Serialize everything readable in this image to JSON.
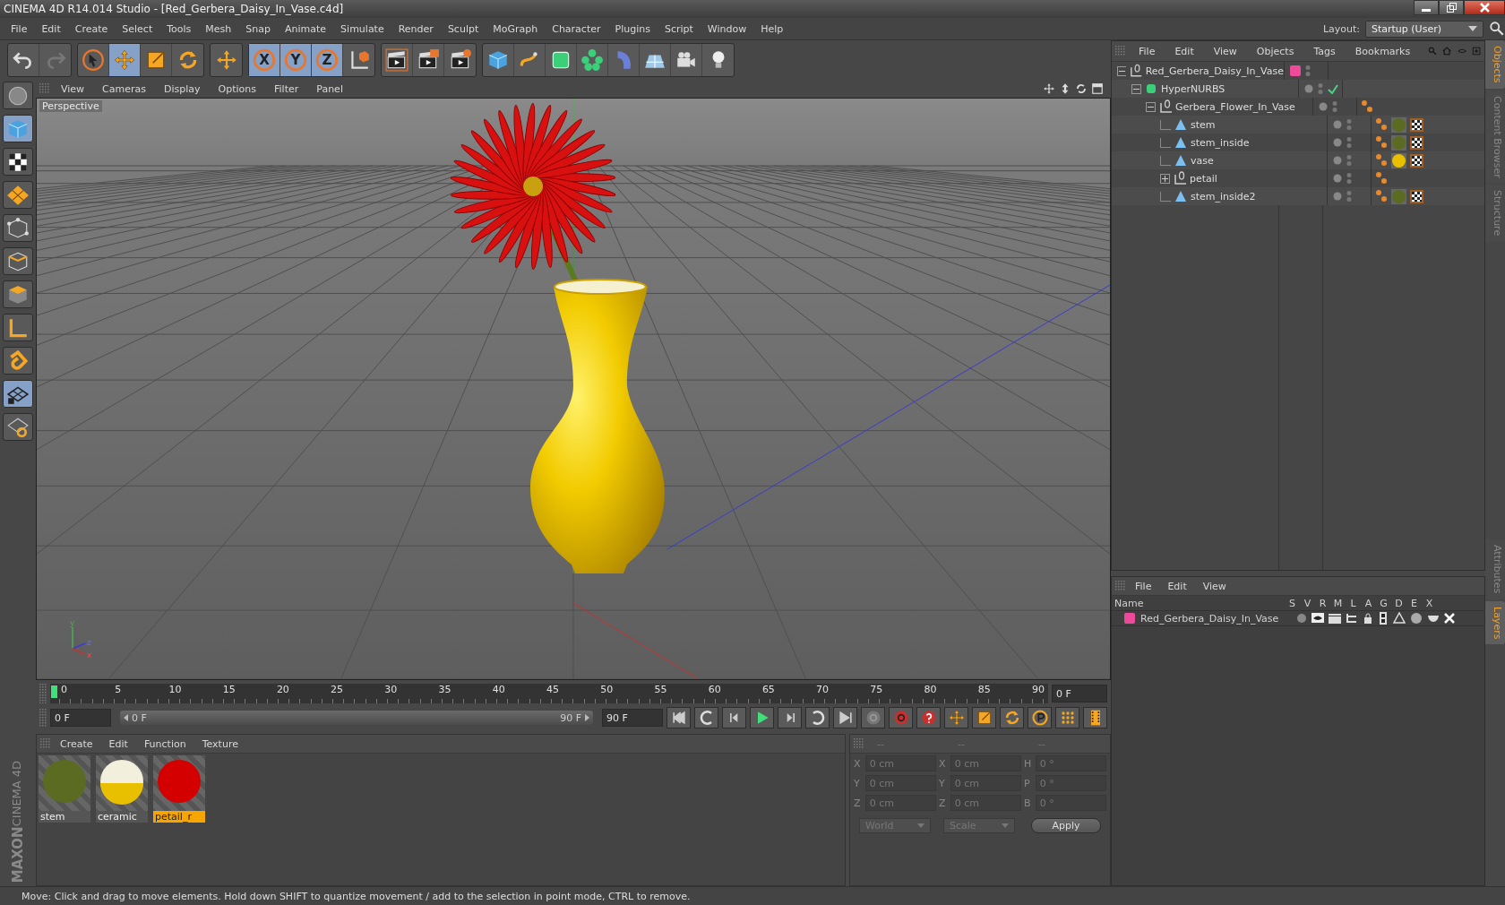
{
  "window": {
    "title": "CINEMA 4D R14.014 Studio - [Red_Gerbera_Daisy_In_Vase.c4d]"
  },
  "menu": [
    "File",
    "Edit",
    "Create",
    "Select",
    "Tools",
    "Mesh",
    "Snap",
    "Animate",
    "Simulate",
    "Render",
    "Sculpt",
    "MoGraph",
    "Character",
    "Plugins",
    "Script",
    "Window",
    "Help"
  ],
  "layout": {
    "label": "Layout:",
    "value": "Startup (User)"
  },
  "toolbar": [
    {
      "items": [
        {
          "kind": "undo",
          "selected": false
        },
        {
          "kind": "redo",
          "selected": false
        }
      ]
    },
    {
      "items": [
        {
          "kind": "select",
          "selected": false
        },
        {
          "kind": "move",
          "selected": true
        },
        {
          "kind": "scale",
          "selected": false
        },
        {
          "kind": "rotate",
          "selected": false
        }
      ]
    },
    {
      "items": [
        {
          "kind": "cross",
          "selected": false
        }
      ]
    },
    {
      "items": [
        {
          "kind": "axis",
          "label": "X",
          "selected": true
        },
        {
          "kind": "axis",
          "label": "Y",
          "selected": true
        },
        {
          "kind": "axis",
          "label": "Z",
          "selected": true
        },
        {
          "kind": "coord",
          "selected": false
        }
      ]
    },
    {
      "items": [
        {
          "kind": "render",
          "selected": false
        },
        {
          "kind": "render2",
          "selected": false
        },
        {
          "kind": "render3",
          "selected": false
        }
      ]
    },
    {
      "items": [
        {
          "kind": "cube",
          "selected": false
        },
        {
          "kind": "spline",
          "selected": false
        },
        {
          "kind": "nurbs",
          "selected": false
        },
        {
          "kind": "cloner",
          "selected": false
        },
        {
          "kind": "bend",
          "selected": false
        },
        {
          "kind": "floor",
          "selected": false
        },
        {
          "kind": "camera",
          "selected": false
        },
        {
          "kind": "light",
          "selected": false
        }
      ]
    }
  ],
  "left_tools": [
    {
      "kind": "ball",
      "selected": false
    },
    {
      "kind": "cube",
      "selected": true
    },
    {
      "kind": "checker",
      "selected": false
    },
    {
      "kind": "plane",
      "selected": false
    },
    {
      "kind": "points",
      "selected": false
    },
    {
      "kind": "edges",
      "selected": false
    },
    {
      "kind": "faces",
      "selected": false
    },
    {
      "kind": "corner",
      "selected": false
    },
    {
      "kind": "magnet",
      "selected": false
    },
    {
      "kind": "lockgrid",
      "selected": true
    },
    {
      "kind": "rotgrid",
      "selected": false
    }
  ],
  "logo": {
    "brand": "MAXON",
    "product": "CINEMA 4D"
  },
  "viewport": {
    "menu": [
      "View",
      "Cameras",
      "Display",
      "Options",
      "Filter",
      "Panel"
    ],
    "camera": "Perspective",
    "axes": [
      "y",
      "z",
      "x"
    ]
  },
  "timeline": {
    "ticks": [
      "0",
      "5",
      "10",
      "15",
      "20",
      "25",
      "30",
      "35",
      "40",
      "45",
      "50",
      "55",
      "60",
      "65",
      "70",
      "75",
      "80",
      "85",
      "90"
    ],
    "current": "0 F",
    "start": "0 F",
    "range": {
      "start": "0 F",
      "end": "90 F",
      "level": 1
    },
    "end": "90 F"
  },
  "transport": [
    {
      "kind": "first"
    },
    {
      "kind": "loopback"
    },
    {
      "kind": "stepback"
    },
    {
      "kind": "play"
    },
    {
      "kind": "stepfwd"
    },
    {
      "kind": "loopfwd"
    },
    {
      "kind": "last"
    },
    {
      "kind": "recoff"
    },
    {
      "kind": "recauto"
    },
    {
      "kind": "help"
    },
    {
      "kind": "move"
    },
    {
      "kind": "scale"
    },
    {
      "kind": "rotate"
    },
    {
      "kind": "param"
    },
    {
      "kind": "dots"
    },
    {
      "kind": "film"
    }
  ],
  "materials": {
    "menu": [
      "Create",
      "Edit",
      "Function",
      "Texture"
    ],
    "items": [
      {
        "name": "stem",
        "kind": "solid",
        "color": "#5b6b22",
        "selected": false
      },
      {
        "name": "ceramic",
        "kind": "twotone",
        "color": "#e8c000",
        "selected": false
      },
      {
        "name": "petail_r",
        "kind": "solid",
        "color": "#d40000",
        "selected": true
      }
    ]
  },
  "coordinates": {
    "headers": [
      "--",
      "--",
      "--"
    ],
    "rows": [
      {
        "labels": [
          "X",
          "X",
          "H"
        ],
        "values": [
          "0 cm",
          "0 cm",
          "0 °"
        ]
      },
      {
        "labels": [
          "Y",
          "Y",
          "P"
        ],
        "values": [
          "0 cm",
          "0 cm",
          "0 °"
        ]
      },
      {
        "labels": [
          "Z",
          "Z",
          "B"
        ],
        "values": [
          "0 cm",
          "0 cm",
          "0 °"
        ]
      }
    ],
    "dropdowns": [
      "World",
      "Scale"
    ],
    "apply": "Apply"
  },
  "objects": {
    "menu": [
      "File",
      "Edit",
      "View",
      "Objects",
      "Tags",
      "Bookmarks"
    ],
    "items": [
      {
        "name": "Red_Gerbera_Daisy_In_Vase",
        "kind": "null",
        "color": "#ee4a9a",
        "expanded": true,
        "children": [
          {
            "name": "HyperNURBS",
            "kind": "nurbs",
            "enabled": true,
            "expanded": true,
            "children": [
              {
                "name": "Gerbera_Flower_In_Vase",
                "kind": "null",
                "expanded": true,
                "tags": [
                  {
                    "kind": "phong"
                  }
                ],
                "children": [
                  {
                    "name": "stem",
                    "kind": "mesh",
                    "tags": [
                      {
                        "kind": "phong"
                      },
                      {
                        "kind": "material",
                        "color": "#5b6b22"
                      },
                      {
                        "kind": "texture"
                      }
                    ]
                  },
                  {
                    "name": "stem_inside",
                    "kind": "mesh",
                    "tags": [
                      {
                        "kind": "phong"
                      },
                      {
                        "kind": "material",
                        "color": "#5b6b22"
                      },
                      {
                        "kind": "texture"
                      }
                    ]
                  },
                  {
                    "name": "vase",
                    "kind": "mesh",
                    "tags": [
                      {
                        "kind": "phong"
                      },
                      {
                        "kind": "material",
                        "color": "#e8c000"
                      },
                      {
                        "kind": "texture"
                      }
                    ]
                  },
                  {
                    "name": "petail",
                    "kind": "null",
                    "expanded": false,
                    "tags": [
                      {
                        "kind": "phong"
                      }
                    ]
                  },
                  {
                    "name": "stem_inside2",
                    "kind": "mesh",
                    "tags": [
                      {
                        "kind": "phong"
                      },
                      {
                        "kind": "material",
                        "color": "#5b6b22"
                      },
                      {
                        "kind": "texture"
                      }
                    ]
                  }
                ]
              }
            ]
          }
        ]
      }
    ]
  },
  "side_tabs_top": [
    {
      "label": "Objects",
      "selected": true
    },
    {
      "label": "Content Browser",
      "selected": false
    },
    {
      "label": "Structure",
      "selected": false
    }
  ],
  "layers": {
    "menu": [
      "File",
      "Edit",
      "View"
    ],
    "columns": [
      "Name",
      "S",
      "V",
      "R",
      "M",
      "L",
      "A",
      "G",
      "D",
      "E",
      "X"
    ],
    "rows": [
      {
        "name": "Red_Gerbera_Daisy_In_Vase",
        "color": "#ee4a9a"
      }
    ]
  },
  "side_tabs_bottom": [
    {
      "label": "Attributes",
      "selected": false
    },
    {
      "label": "Layers",
      "selected": true
    }
  ],
  "status_bar": "Move: Click and drag to move elements. Hold down SHIFT to quantize movement / add to the selection in point mode, CTRL to remove."
}
